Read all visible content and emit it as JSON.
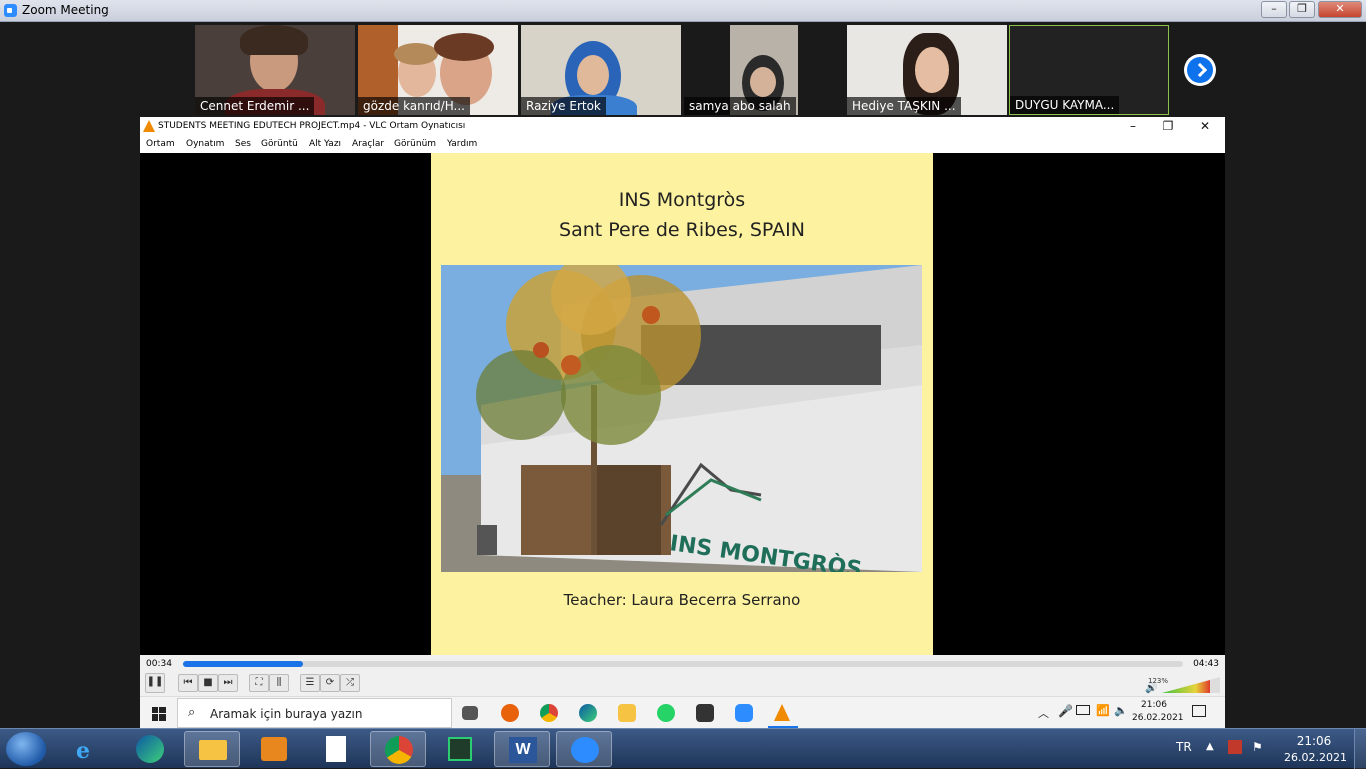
{
  "zoom": {
    "window_title": "Zoom Meeting",
    "window_controls": {
      "minimize": "–",
      "maximize": "❐",
      "close": "✕"
    },
    "participants": [
      {
        "name": "Cennet Erdemir ..."
      },
      {
        "name": "gözde kanrıd/H..."
      },
      {
        "name": "Raziye Ertok"
      },
      {
        "name": "samya abo salah"
      },
      {
        "name": "Hediye TAŞKIN ..."
      },
      {
        "name": "DUYGU KAYMA..."
      }
    ]
  },
  "vlc": {
    "title": "STUDENTS MEETING EDUTECH PROJECT.mp4 - VLC Ortam Oynatıcısı",
    "window_controls": {
      "minimize": "–",
      "maximize": "❐",
      "close": "✕"
    },
    "menu": [
      "Ortam",
      "Oynatım",
      "Ses",
      "Görüntü",
      "Alt Yazı",
      "Araçlar",
      "Görünüm",
      "Yardım"
    ],
    "slide": {
      "line1": "INS Montgròs",
      "line2": "Sant Pere de Ribes, SPAIN",
      "sign_text": "INS MONTGRÒS",
      "teacher": "Teacher:  Laura Becerra Serrano"
    },
    "time_current": "00:34",
    "time_total": "04:43",
    "progress_fraction": 0.12,
    "volume_percent": "123%",
    "accent": "#1a73e8"
  },
  "inner_taskbar": {
    "search_placeholder": "Aramak için buraya yazın",
    "time": "21:06",
    "date": "26.02.2021"
  },
  "outer_taskbar": {
    "language": "TR",
    "time": "21:06",
    "date": "26.02.2021"
  }
}
